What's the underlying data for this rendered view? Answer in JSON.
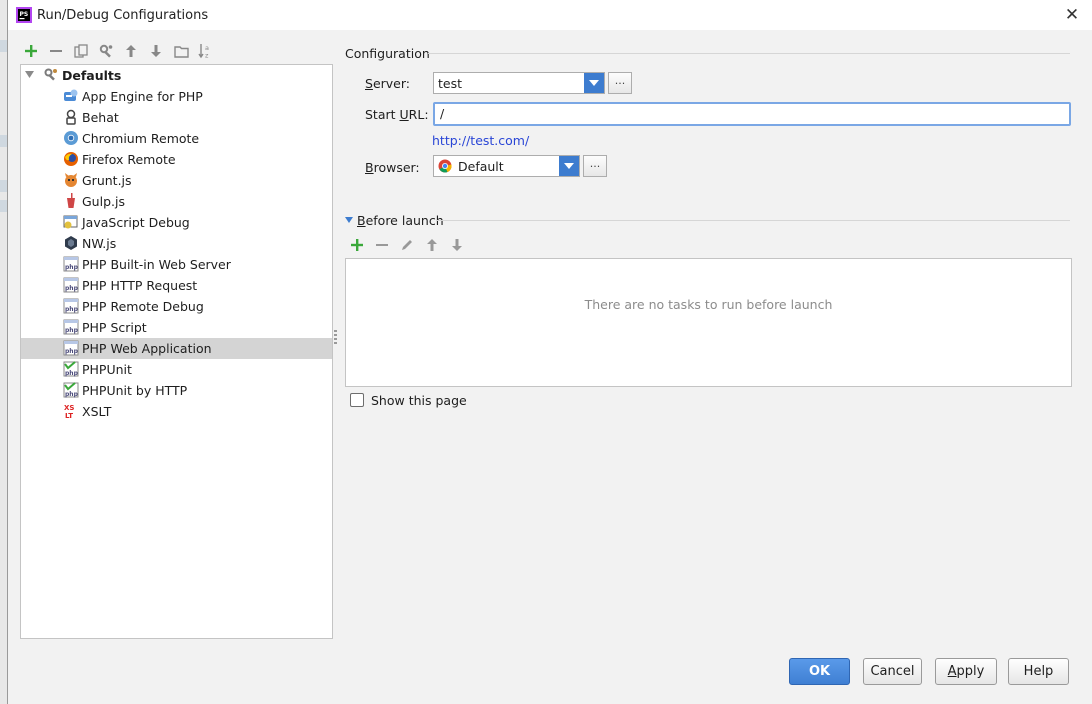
{
  "window": {
    "title": "Run/Debug Configurations"
  },
  "toolbar": {
    "icons": [
      "add-icon",
      "remove-icon",
      "copy-icon",
      "edit-defaults-icon",
      "move-up-icon",
      "move-down-icon",
      "folder-icon",
      "sort-icon"
    ]
  },
  "tree": {
    "root": {
      "label": "Defaults",
      "icon": "defaults-icon"
    },
    "items": [
      {
        "label": "App Engine for PHP",
        "icon": "app-engine-icon"
      },
      {
        "label": "Behat",
        "icon": "behat-icon"
      },
      {
        "label": "Chromium Remote",
        "icon": "chromium-icon"
      },
      {
        "label": "Firefox Remote",
        "icon": "firefox-icon"
      },
      {
        "label": "Grunt.js",
        "icon": "grunt-icon"
      },
      {
        "label": "Gulp.js",
        "icon": "gulp-icon"
      },
      {
        "label": "JavaScript Debug",
        "icon": "javascript-debug-icon"
      },
      {
        "label": "NW.js",
        "icon": "nwjs-icon"
      },
      {
        "label": "PHP Built-in Web Server",
        "icon": "php-icon"
      },
      {
        "label": "PHP HTTP Request",
        "icon": "php-icon"
      },
      {
        "label": "PHP Remote Debug",
        "icon": "php-icon"
      },
      {
        "label": "PHP Script",
        "icon": "php-icon"
      },
      {
        "label": "PHP Web Application",
        "icon": "php-icon",
        "selected": true
      },
      {
        "label": "PHPUnit",
        "icon": "phpunit-icon"
      },
      {
        "label": "PHPUnit by HTTP",
        "icon": "phpunit-icon"
      },
      {
        "label": "XSLT",
        "icon": "xslt-icon"
      }
    ]
  },
  "configuration": {
    "section_title": "Configuration",
    "server_label": "Server:",
    "server_value": "test",
    "start_url_label": "Start URL:",
    "start_url_value": "/",
    "resolved_url": "http://test.com/",
    "browser_label": "Browser:",
    "browser_value": "Default",
    "ellipsis": "..."
  },
  "before_launch": {
    "section_title": "Before launch",
    "empty_text": "There are no tasks to run before launch",
    "show_page_label": "Show this page",
    "show_page_checked": false
  },
  "buttons": {
    "ok": "OK",
    "cancel": "Cancel",
    "apply": "Apply",
    "help": "Help"
  },
  "colors": {
    "accent": "#3d7ccf",
    "selection": "#d4d4d4",
    "link": "#2a46d6",
    "add_green": "#3aa83a"
  }
}
